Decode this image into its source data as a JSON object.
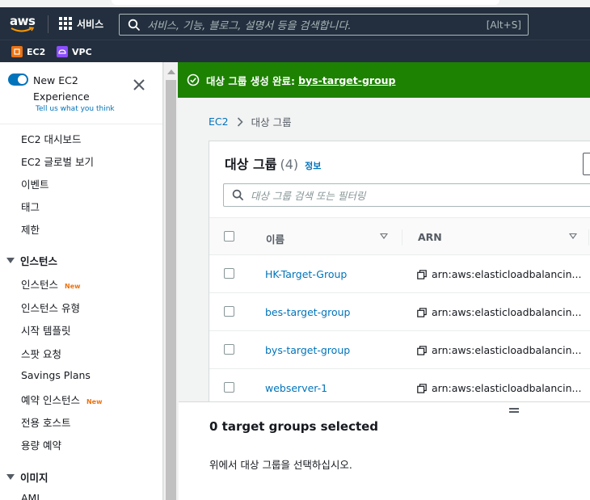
{
  "header": {
    "logo_text": "aws",
    "services_label": "서비스",
    "search_placeholder": "서비스, 기능, 블로그, 설명서 등을 검색합니다.",
    "search_shortcut": "[Alt+S]",
    "favorites": [
      {
        "label": "EC2",
        "color": "#ec7211"
      },
      {
        "label": "VPC",
        "color": "#8c4fff"
      }
    ]
  },
  "sidebar": {
    "toggle_label": "New EC2 Experience",
    "toggle_on": true,
    "feedback_link": "Tell us what you think",
    "items": [
      {
        "label": "EC2 대시보드"
      },
      {
        "label": "EC2 글로벌 보기"
      },
      {
        "label": "이벤트"
      },
      {
        "label": "태그"
      },
      {
        "label": "제한"
      }
    ],
    "section_instances": {
      "label": "인스턴스",
      "items": [
        {
          "label": "인스턴스",
          "badge": "New"
        },
        {
          "label": "인스턴스 유형"
        },
        {
          "label": "시작 템플릿"
        },
        {
          "label": "스팟 요청"
        },
        {
          "label": "Savings Plans"
        },
        {
          "label": "예약 인스턴스",
          "badge": "New"
        },
        {
          "label": "전용 호스트"
        },
        {
          "label": "용량 예약"
        }
      ]
    },
    "section_images": {
      "label": "이미지",
      "items": [
        {
          "label": "AMI"
        }
      ]
    }
  },
  "flash": {
    "message": "대상 그룹 생성 완료:",
    "link": "bys-target-group",
    "color": "#1d8102"
  },
  "breadcrumb": {
    "root": "EC2",
    "current": "대상 그룹"
  },
  "table": {
    "title": "대상 그룹",
    "count": "(4)",
    "info_link": "정보",
    "filter_placeholder": "대상 그룹 검색 또는 필터링",
    "columns": [
      "이름",
      "ARN"
    ],
    "rows": [
      {
        "name": "HK-Target-Group",
        "arn": "arn:aws:elasticloadbalancin..."
      },
      {
        "name": "bes-target-group",
        "arn": "arn:aws:elasticloadbalancin..."
      },
      {
        "name": "bys-target-group",
        "arn": "arn:aws:elasticloadbalancin..."
      },
      {
        "name": "webserver-1",
        "arn": "arn:aws:elasticloadbalancin..."
      }
    ]
  },
  "details": {
    "title": "0 target groups selected",
    "hint": "위에서 대상 그룹을 선택하십시오."
  }
}
